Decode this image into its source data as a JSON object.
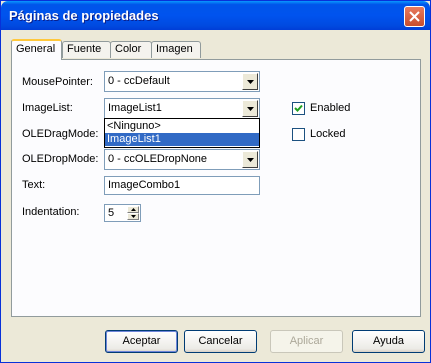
{
  "window": {
    "title": "Páginas de propiedades"
  },
  "tabs": [
    {
      "label": "General",
      "active": true
    },
    {
      "label": "Fuente",
      "active": false
    },
    {
      "label": "Color",
      "active": false
    },
    {
      "label": "Imagen",
      "active": false
    }
  ],
  "fields": {
    "mouse_pointer": {
      "label": "MousePointer:",
      "value": "0 - ccDefault"
    },
    "image_list": {
      "label": "ImageList:",
      "value": "ImageList1",
      "options": [
        "<Ninguno>",
        "ImageList1"
      ],
      "selected_index": 1
    },
    "ole_drag_mode": {
      "label": "OLEDragMode:"
    },
    "ole_drop_mode": {
      "label": "OLEDropMode:",
      "value": "0 - ccOLEDropNone"
    },
    "text": {
      "label": "Text:",
      "value": "ImageCombo1"
    },
    "indentation": {
      "label": "Indentation:",
      "value": "5"
    }
  },
  "checkboxes": {
    "enabled": {
      "label": "Enabled",
      "checked": true
    },
    "locked": {
      "label": "Locked",
      "checked": false
    }
  },
  "buttons": {
    "ok": "Aceptar",
    "cancel": "Cancelar",
    "apply": "Aplicar",
    "help": "Ayuda"
  },
  "icons": {
    "close": "close-icon",
    "dropdown": "chevron-down-icon",
    "check": "checkmark-icon"
  }
}
